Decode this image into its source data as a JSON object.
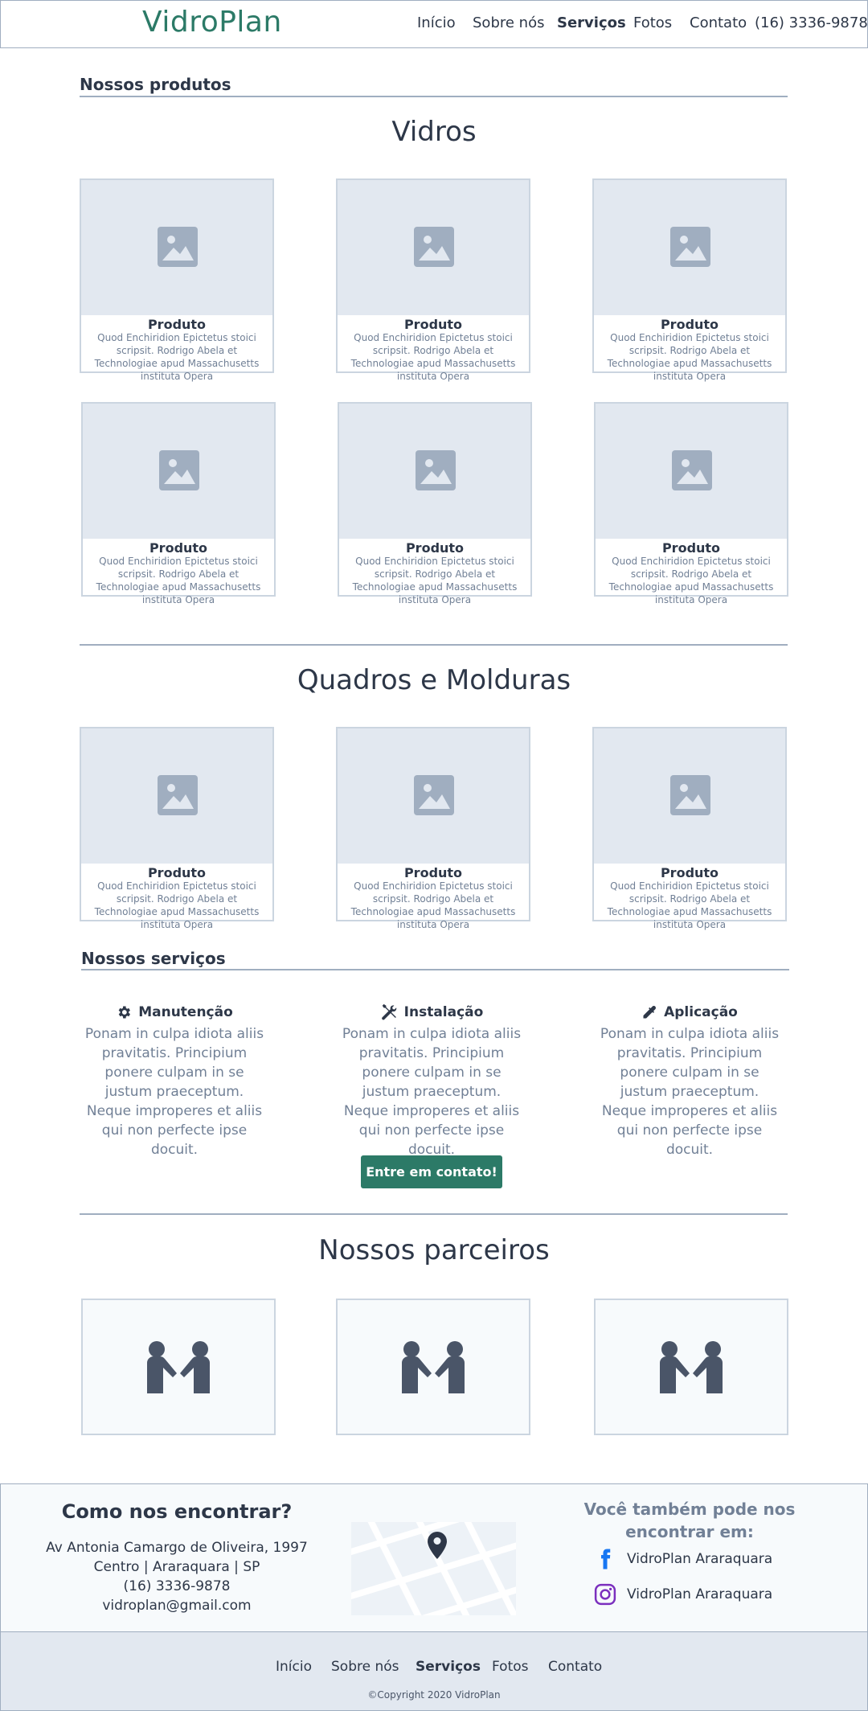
{
  "header": {
    "brand": "VidroPlan",
    "nav": [
      "Início",
      "Sobre nós",
      "Serviços",
      "Fotos",
      "Contato"
    ],
    "active_nav": "Serviços",
    "phone": "(16) 3336-9878"
  },
  "products": {
    "section_title": "Nossos produtos",
    "vidros_title": "Vidros",
    "quadros_title": "Quadros e Molduras",
    "card_name": "Produto",
    "card_desc": "Quod Enchiridion Epictetus stoici scripsit. Rodrigo Abela et Technologiae apud Massachusetts instituta Opera",
    "vidros": [
      {
        "name": "Produto",
        "desc": "Quod Enchiridion Epictetus stoici scripsit. Rodrigo Abela et Technologiae apud Massachusetts instituta Opera"
      },
      {
        "name": "Produto",
        "desc": "Quod Enchiridion Epictetus stoici scripsit. Rodrigo Abela et Technologiae apud Massachusetts instituta Opera"
      },
      {
        "name": "Produto",
        "desc": "Quod Enchiridion Epictetus stoici scripsit. Rodrigo Abela et Technologiae apud Massachusetts instituta Opera"
      },
      {
        "name": "Produto",
        "desc": "Quod Enchiridion Epictetus stoici scripsit. Rodrigo Abela et Technologiae apud Massachusetts instituta Opera"
      },
      {
        "name": "Produto",
        "desc": "Quod Enchiridion Epictetus stoici scripsit. Rodrigo Abela et Technologiae apud Massachusetts instituta Opera"
      },
      {
        "name": "Produto",
        "desc": "Quod Enchiridion Epictetus stoici scripsit. Rodrigo Abela et Technologiae apud Massachusetts instituta Opera"
      }
    ],
    "quadros": [
      {
        "name": "Produto",
        "desc": "Quod Enchiridion Epictetus stoici scripsit. Rodrigo Abela et Technologiae apud Massachusetts instituta Opera"
      },
      {
        "name": "Produto",
        "desc": "Quod Enchiridion Epictetus stoici scripsit. Rodrigo Abela et Technologiae apud Massachusetts instituta Opera"
      },
      {
        "name": "Produto",
        "desc": "Quod Enchiridion Epictetus stoici scripsit. Rodrigo Abela et Technologiae apud Massachusetts instituta Opera"
      }
    ]
  },
  "services": {
    "section_title": "Nossos serviços",
    "items": [
      {
        "title": "Manutenção",
        "icon": "gear-icon",
        "text": "Ponam in culpa idiota aliis pravitatis. Principium ponere culpam in se justum praeceptum. Neque improperes et aliis qui non perfecte ipse docuit."
      },
      {
        "title": "Instalação",
        "icon": "tools-icon",
        "text": "Ponam in culpa idiota aliis pravitatis. Principium ponere culpam in se justum praeceptum. Neque improperes et aliis qui non perfecte ipse docuit."
      },
      {
        "title": "Aplicação",
        "icon": "eyedropper-icon",
        "text": "Ponam in culpa idiota aliis pravitatis. Principium ponere culpam in se justum praeceptum. Neque improperes et aliis qui non perfecte ipse docuit."
      }
    ],
    "cta_label": "Entre em contato!"
  },
  "partners": {
    "title": "Nossos parceiros",
    "icon": "handshake-icon"
  },
  "find": {
    "title": "Como nos encontrar?",
    "address_line1": "Av Antonia Camargo de Oliveira, 1997",
    "address_line2": "Centro | Araraquara | SP",
    "phone": "(16) 3336-9878",
    "email": "vidroplan@gmail.com",
    "social_title": "Você também pode nos encontrar em:",
    "facebook": "VidroPlan Araraquara",
    "instagram": "VidroPlan Araraquara"
  },
  "footer": {
    "nav": [
      "Início",
      "Sobre nós",
      "Serviços",
      "Fotos",
      "Contato"
    ],
    "copyright": "©Copyright 2020 VidroPlan"
  },
  "colors": {
    "brand": "#2c7a67",
    "text": "#2d3748",
    "muted": "#718096",
    "placeholder": "#e2e8f0",
    "border": "#a0aec0",
    "instagram": "#7b2fbe",
    "facebook": "#1877f2"
  }
}
